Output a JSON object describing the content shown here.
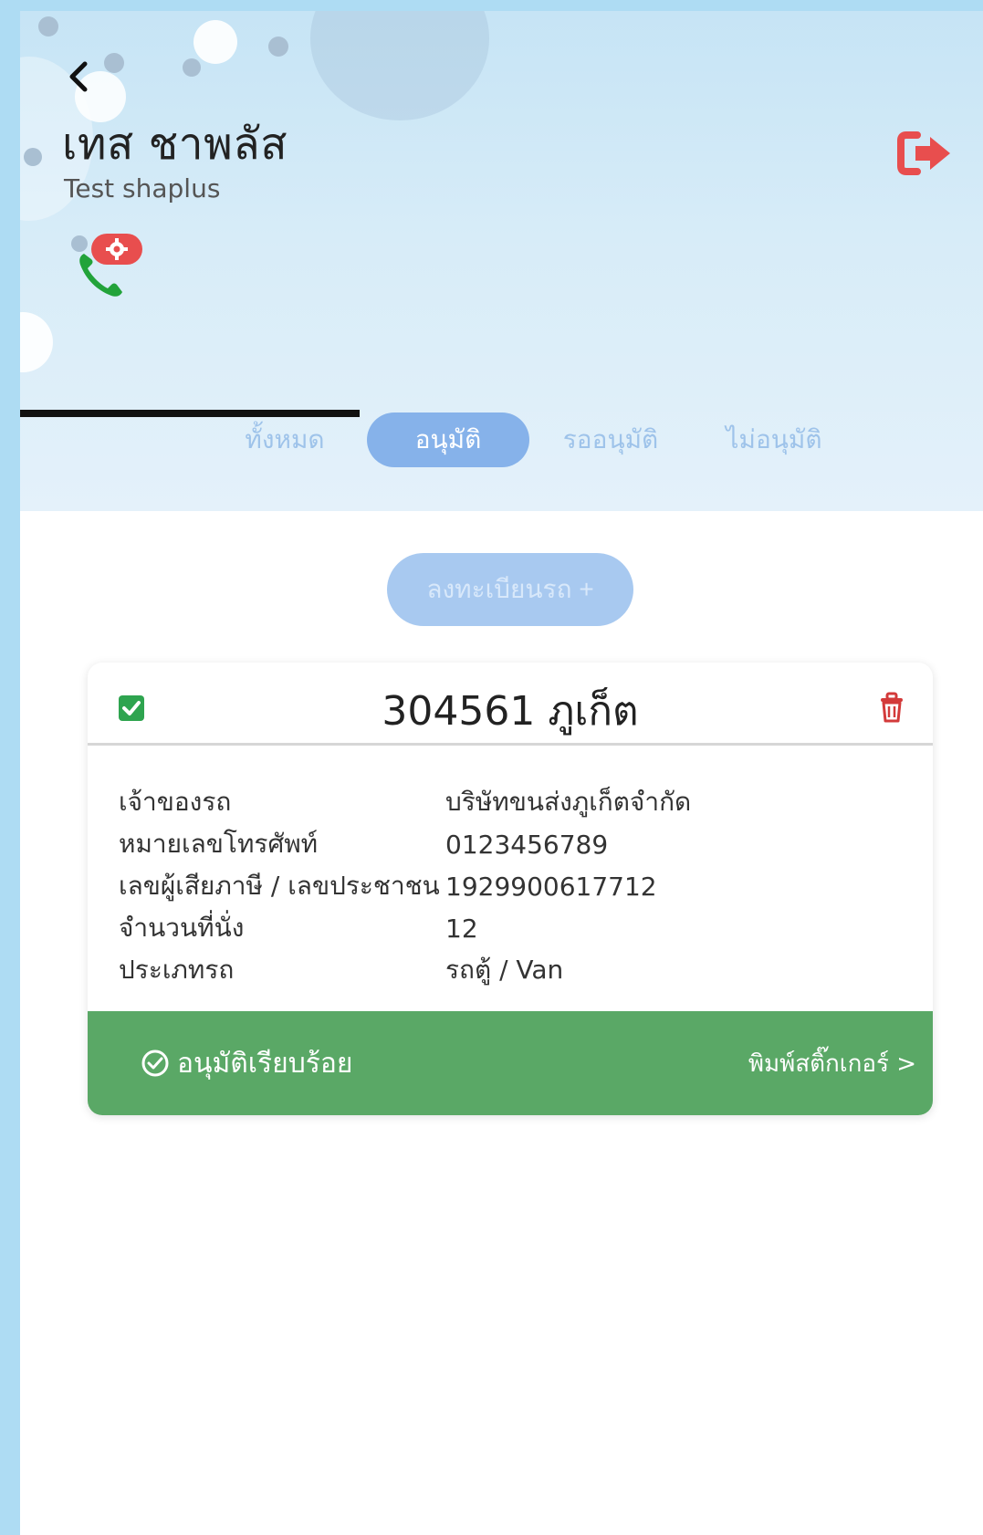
{
  "header": {
    "title_th": "เทส ชาพลัส",
    "title_en": "Test shaplus"
  },
  "tabs": [
    {
      "label": "ทั้งหมด",
      "active": false
    },
    {
      "label": "อนุมัติ",
      "active": true
    },
    {
      "label": "รออนุมัติ",
      "active": false
    },
    {
      "label": "ไม่อนุมัติ",
      "active": false
    }
  ],
  "register_button": "ลงทะเบียนรถ +",
  "vehicle": {
    "title": "304561 ภูเก็ต",
    "details": [
      {
        "label": "เจ้าของรถ",
        "value": "บริษัทขนส่งภูเก็ตจำกัด"
      },
      {
        "label": "หมายเลขโทรศัพท์",
        "value": "0123456789"
      },
      {
        "label": "เลขผู้เสียภาษี / เลขประชาชน",
        "value": "1929900617712"
      },
      {
        "label": "จำนวนที่นั่ง",
        "value": "12"
      },
      {
        "label": "ประเภทรถ",
        "value": "รถตู้ / Van"
      }
    ],
    "status": "อนุมัติเรียบร้อย",
    "print_link": "พิมพ์สติ๊กเกอร์ >"
  },
  "icons": {
    "back": "chevron-left-icon",
    "logout": "logout-icon",
    "phone": "phone-icon",
    "settings_badge": "gear-icon",
    "checkbox": "checkbox-checked-icon",
    "trash": "trash-icon",
    "status": "check-circle-icon"
  },
  "colors": {
    "header_bg": "#cfe7f6",
    "active_tab": "#86b2ea",
    "register_button": "#a8c9f0",
    "approved_green": "#5aa866",
    "logout_red": "#e84e4e",
    "phone_green": "#22a33a",
    "checkbox_green": "#2ea44f",
    "trash_red": "#d33a3a"
  }
}
